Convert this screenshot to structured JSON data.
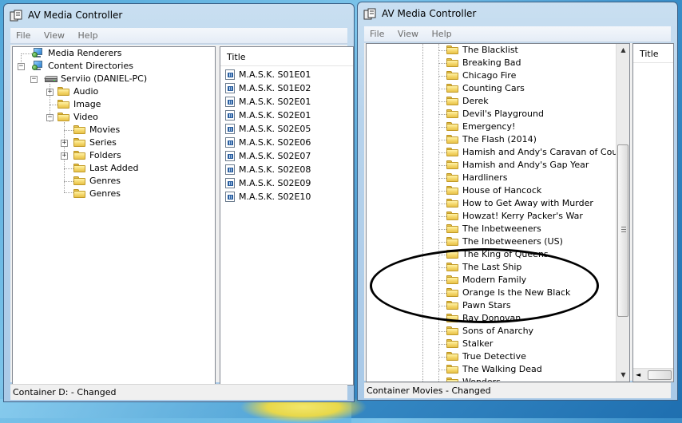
{
  "left_window": {
    "title": "AV Media Controller",
    "menu": [
      "File",
      "View",
      "Help"
    ],
    "tree": {
      "media_renderers": "Media Renderers",
      "content_directories": "Content Directories",
      "server": "Serviio (DANIEL-PC)",
      "audio": "Audio",
      "image": "Image",
      "video": "Video",
      "movies": "Movies",
      "series": "Series",
      "folders": "Folders",
      "last_added": "Last Added",
      "genres_1": "Genres",
      "genres_2": "Genres"
    },
    "list_header": "Title",
    "files": [
      "M.A.S.K. S01E01",
      "M.A.S.K. S01E02",
      "M.A.S.K. S02E01",
      "M.A.S.K. S02E01",
      "M.A.S.K. S02E05",
      "M.A.S.K. S02E06",
      "M.A.S.K. S02E07",
      "M.A.S.K. S02E08",
      "M.A.S.K. S02E09",
      "M.A.S.K. S02E10"
    ],
    "status": "Container D: - Changed"
  },
  "right_window": {
    "title": "AV Media Controller",
    "menu": [
      "File",
      "View",
      "Help"
    ],
    "list_header": "Title",
    "series": [
      "The Blacklist",
      "Breaking Bad",
      "Chicago Fire",
      "Counting Cars",
      "Derek",
      "Devil's Playground",
      "Emergency!",
      "The Flash (2014)",
      "Hamish and Andy's Caravan of Courage",
      "Hamish and Andy's Gap Year",
      "Hardliners",
      "House of Hancock",
      "How to Get Away with Murder",
      "Howzat! Kerry Packer's War",
      "The Inbetweeners",
      "The Inbetweeners (US)",
      "The King of Queens",
      "The Last Ship",
      "Modern Family",
      "Orange Is the New Black",
      "Pawn Stars",
      "Ray Donovan",
      "Sons of Anarchy",
      "Stalker",
      "True Detective",
      "The Walking Dead",
      "Wonders"
    ],
    "status": "Container Movies - Changed"
  },
  "annotation": {
    "shape": "ellipse",
    "color": "#000000"
  }
}
